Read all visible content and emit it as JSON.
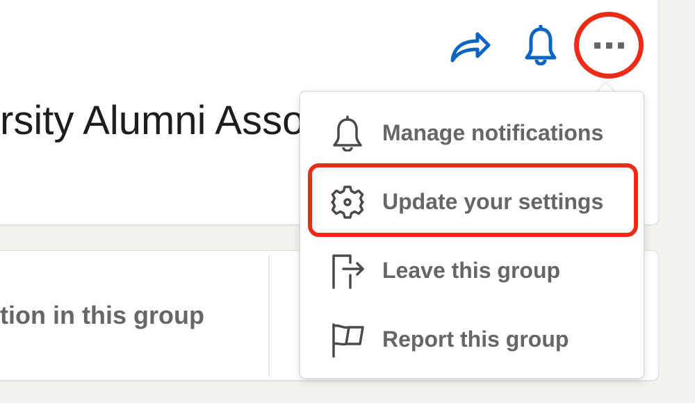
{
  "group_header": {
    "title": "rsity Alumni Asso"
  },
  "actions": {
    "share_icon": "share-icon",
    "bell_icon": "bell-icon",
    "more_icon": "more-horizontal-icon"
  },
  "content_card": {
    "tab_text": "tion in this group"
  },
  "menu": {
    "items": [
      {
        "label": "Manage notifications",
        "icon": "bell-icon"
      },
      {
        "label": "Update your settings",
        "icon": "gear-icon"
      },
      {
        "label": "Leave this group",
        "icon": "leave-group-icon"
      },
      {
        "label": "Report this group",
        "icon": "flag-icon"
      }
    ]
  },
  "colors": {
    "accent_blue": "#0a66c2",
    "highlight_red": "#ee2b16",
    "menu_text": "#666666",
    "icon_gray": "#4a4a4a"
  }
}
